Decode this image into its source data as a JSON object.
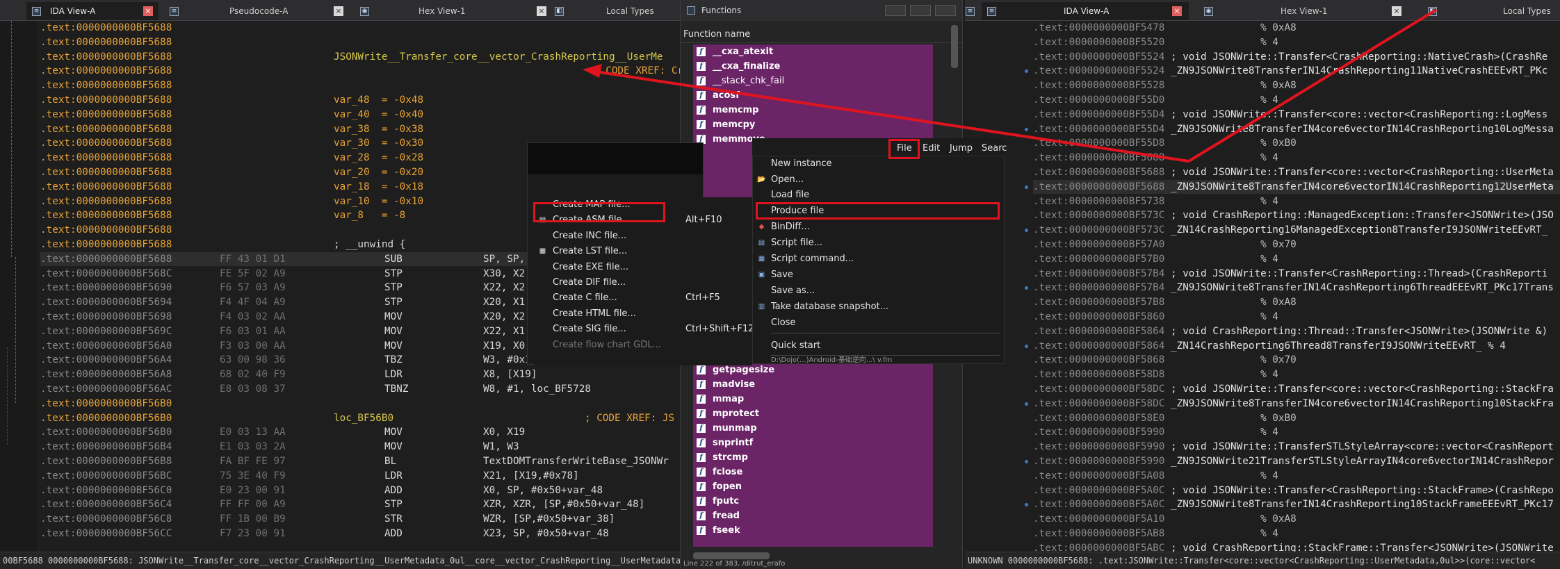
{
  "left": {
    "tabs": [
      {
        "label": "IDA View-A",
        "icon": "ida-view-icon",
        "active": true
      },
      {
        "label": "Pseudocode-A",
        "icon": "pseudocode-icon"
      },
      {
        "label": "Hex View-1",
        "icon": "hex-view-icon"
      },
      {
        "label": "Local Types",
        "icon": "local-types-icon"
      }
    ],
    "lines": [
      {
        "addr": ".text:0000000000BF5688",
        "hex": "",
        "a": "",
        "b": "",
        "c": ""
      },
      {
        "addr": ".text:0000000000BF5688",
        "hex": "",
        "a": "",
        "b": "",
        "c": ""
      },
      {
        "addr": ".text:0000000000BF5688",
        "hex": "",
        "a": "JSONWrite__Transfer_core__vector_CrashReporting__UserMe",
        "b": "",
        "c": ""
      },
      {
        "addr": ".text:0000000000BF5688",
        "hex": "",
        "a": "",
        "b": "",
        "c": "; CODE XREF: Cr"
      },
      {
        "addr": ".text:0000000000BF5688",
        "hex": "",
        "a": "",
        "b": "",
        "c": ""
      },
      {
        "addr": ".text:0000000000BF5688",
        "hex": "",
        "a": "var_48  = -0x48",
        "b": "",
        "c": ""
      },
      {
        "addr": ".text:0000000000BF5688",
        "hex": "",
        "a": "var_40  = -0x40",
        "b": "",
        "c": ""
      },
      {
        "addr": ".text:0000000000BF5688",
        "hex": "",
        "a": "var_38  = -0x38",
        "b": "",
        "c": ""
      },
      {
        "addr": ".text:0000000000BF5688",
        "hex": "",
        "a": "var_30  = -0x30",
        "b": "",
        "c": ""
      },
      {
        "addr": ".text:0000000000BF5688",
        "hex": "",
        "a": "var_28  = -0x28",
        "b": "",
        "c": ""
      },
      {
        "addr": ".text:0000000000BF5688",
        "hex": "",
        "a": "var_20  = -0x20",
        "b": "",
        "c": ""
      },
      {
        "addr": ".text:0000000000BF5688",
        "hex": "",
        "a": "var_18  = -0x18",
        "b": "",
        "c": ""
      },
      {
        "addr": ".text:0000000000BF5688",
        "hex": "",
        "a": "var_10  = -0x10",
        "b": "",
        "c": ""
      },
      {
        "addr": ".text:0000000000BF5688",
        "hex": "",
        "a": "var_8   = -8",
        "b": "",
        "c": ""
      },
      {
        "addr": ".text:0000000000BF5688",
        "hex": "",
        "a": "",
        "b": "",
        "c": ""
      },
      {
        "addr": ".text:0000000000BF5688",
        "hex": "",
        "a": "; __unwind {",
        "b": "",
        "c": ""
      },
      {
        "addr": ".text:0000000000BF5688",
        "hex": "FF 43 01 D1",
        "a": "SUB",
        "b": "SP, SP,",
        "c": ""
      },
      {
        "addr": ".text:0000000000BF568C",
        "hex": "FE 5F 02 A9",
        "a": "STP",
        "b": "X30, X2",
        "c": ""
      },
      {
        "addr": ".text:0000000000BF5690",
        "hex": "F6 57 03 A9",
        "a": "STP",
        "b": "X22, X2",
        "c": ""
      },
      {
        "addr": ".text:0000000000BF5694",
        "hex": "F4 4F 04 A9",
        "a": "STP",
        "b": "X20, X1",
        "c": ""
      },
      {
        "addr": ".text:0000000000BF5698",
        "hex": "F4 03 02 AA",
        "a": "MOV",
        "b": "X20, X2",
        "c": ""
      },
      {
        "addr": ".text:0000000000BF569C",
        "hex": "F6 03 01 AA",
        "a": "MOV",
        "b": "X22, X1",
        "c": ""
      },
      {
        "addr": ".text:0000000000BF56A0",
        "hex": "F3 03 00 AA",
        "a": "MOV",
        "b": "X19, X0",
        "c": ""
      },
      {
        "addr": ".text:0000000000BF56A4",
        "hex": "63 00 98 36",
        "a": "TBZ",
        "b": "W3, #0x13, loc_BF56B0",
        "c": ""
      },
      {
        "addr": ".text:0000000000BF56A8",
        "hex": "68 02 40 F9",
        "a": "LDR",
        "b": "X8, [X19]",
        "c": ""
      },
      {
        "addr": ".text:0000000000BF56AC",
        "hex": "E8 03 08 37",
        "a": "TBNZ",
        "b": "W8, #1, loc_BF5728",
        "c": ""
      },
      {
        "addr": ".text:0000000000BF56B0",
        "hex": "",
        "a": "",
        "b": "",
        "c": ""
      },
      {
        "addr": ".text:0000000000BF56B0",
        "hex": "",
        "a": "loc_BF56B0",
        "b": "",
        "c": "; CODE XREF: JS"
      },
      {
        "addr": ".text:0000000000BF56B0",
        "hex": "E0 03 13 AA",
        "a": "MOV",
        "b": "X0, X19",
        "c": ""
      },
      {
        "addr": ".text:0000000000BF56B4",
        "hex": "E1 03 03 2A",
        "a": "MOV",
        "b": "W1, W3",
        "c": ""
      },
      {
        "addr": ".text:0000000000BF56B8",
        "hex": "FA BF FE 97",
        "a": "BL",
        "b": "TextDOMTransferWriteBase_JSONWr",
        "c": ""
      },
      {
        "addr": ".text:0000000000BF56BC",
        "hex": "75 3E 40 F9",
        "a": "LDR",
        "b": "X21, [X19,#0x78]",
        "c": ""
      },
      {
        "addr": ".text:0000000000BF56C0",
        "hex": "E0 23 00 91",
        "a": "ADD",
        "b": "X0, SP, #0x50+var_48",
        "c": ""
      },
      {
        "addr": ".text:0000000000BF56C4",
        "hex": "FF FF 00 A9",
        "a": "STP",
        "b": "XZR, XZR, [SP,#0x50+var_48]",
        "c": ""
      },
      {
        "addr": ".text:0000000000BF56C8",
        "hex": "FF 1B 00 B9",
        "a": "STR",
        "b": "WZR, [SP,#0x50+var_38]",
        "c": ""
      },
      {
        "addr": ".text:0000000000BF56CC",
        "hex": "F7 23 00 91",
        "a": "ADD",
        "b": "X23, SP, #0x50+var_48",
        "c": ""
      }
    ],
    "status": "00BF5688 0000000000BF5688: JSONWrite__Transfer_core__vector_CrashReporting__UserMetadata_0ul__core__vector_CrashReporting__UserMetadata"
  },
  "functions": {
    "title": "Functions",
    "header": "Function name",
    "top_items": [
      "__cxa_atexit",
      "__cxa_finalize",
      "__stack_chk_fail",
      "acosf",
      "memcmp",
      "memcpy",
      "memmove"
    ],
    "bottom_items": [
      "getpagesize",
      "madvise",
      "mmap",
      "mprotect",
      "munmap",
      "snprintf",
      "strcmp",
      "fclose",
      "fopen",
      "fputc",
      "fread",
      "fseek"
    ],
    "footer": "Line 222 of 383, /ditrut_erafo"
  },
  "menubar": {
    "items": [
      "File",
      "Edit",
      "Jump",
      "Searc"
    ]
  },
  "file_menu": {
    "items": [
      {
        "label": "New instance",
        "icon": "",
        "interactable": true
      },
      {
        "label": "Open...",
        "icon": "folder-open-icon",
        "interactable": true
      },
      {
        "label": "Load file",
        "icon": "",
        "interactable": true
      },
      {
        "label": "Produce file",
        "icon": "",
        "interactable": true
      },
      {
        "label": "BinDiff...",
        "icon": "bindiff-icon",
        "interactable": true
      },
      {
        "label": "Script file...",
        "icon": "script-file-icon",
        "interactable": true
      },
      {
        "label": "Script command...",
        "icon": "script-command-icon",
        "interactable": true
      },
      {
        "label": "Save",
        "icon": "save-icon",
        "interactable": true
      },
      {
        "label": "Save as...",
        "icon": "",
        "interactable": true
      },
      {
        "label": "Take database snapshot...",
        "icon": "snapshot-icon",
        "interactable": true
      },
      {
        "label": "Close",
        "icon": "",
        "interactable": true
      },
      {
        "label": "Quick start",
        "icon": "",
        "interactable": true
      }
    ],
    "recent": "D:\\Dojo(...)Android-基础逆向...\\ v.fm"
  },
  "produce_submenu": {
    "items": [
      {
        "label": "Create MAP file...",
        "shortcut": ""
      },
      {
        "label": "Create ASM file...",
        "shortcut": "Alt+F10"
      },
      {
        "label": "Create INC file...",
        "shortcut": ""
      },
      {
        "label": "Create LST file...",
        "shortcut": ""
      },
      {
        "label": "Create EXE file...",
        "shortcut": ""
      },
      {
        "label": "Create DIF file...",
        "shortcut": ""
      },
      {
        "label": "Create C file...",
        "shortcut": "Ctrl+F5"
      },
      {
        "label": "Create HTML file...",
        "shortcut": ""
      },
      {
        "label": "Create SIG file...",
        "shortcut": "Ctrl+Shift+F12"
      },
      {
        "label": "Create flow chart GDL...",
        "shortcut": "",
        "disabled": true
      }
    ]
  },
  "right": {
    "tabs": [
      {
        "label": "IDA View-A",
        "icon": "ida-view-icon",
        "active": true
      },
      {
        "label": "Hex View-1",
        "icon": "hex-view-icon"
      },
      {
        "label": "Local Types",
        "icon": "local-types-icon"
      }
    ],
    "lines": [
      {
        "addr": ".text:0000000000BF5478",
        "body": "                % 0xA8",
        "kind": "pct"
      },
      {
        "addr": ".text:0000000000BF5520",
        "body": "                % 4",
        "kind": "pct"
      },
      {
        "addr": ".text:0000000000BF5524",
        "body": " ; void JSONWrite::Transfer<CrashReporting::NativeCrash>(CrashRe",
        "kind": "decl"
      },
      {
        "addr": ".text:0000000000BF5524",
        "body": " _ZN9JSONWrite8TransferIN14CrashReporting11NativeCrashEEEvRT_PKc",
        "kind": "decl"
      },
      {
        "addr": ".text:0000000000BF5528",
        "body": "                % 0xA8",
        "kind": "pct"
      },
      {
        "addr": ".text:0000000000BF55D0",
        "body": "                % 4",
        "kind": "pct"
      },
      {
        "addr": ".text:0000000000BF55D4",
        "body": " ; void JSONWrite::Transfer<core::vector<CrashReporting::LogMess",
        "kind": "decl"
      },
      {
        "addr": ".text:0000000000BF55D4",
        "body": " _ZN9JSONWrite8TransferIN4core6vectorIN14CrashReporting10LogMessa",
        "kind": "decl"
      },
      {
        "addr": ".text:0000000000BF55D8",
        "body": "                % 0xB0",
        "kind": "pct"
      },
      {
        "addr": ".text:0000000000BF5688",
        "body": "                % 4",
        "kind": "pct"
      },
      {
        "addr": ".text:0000000000BF5688",
        "body": " ; void JSONWrite::Transfer<core::vector<CrashReporting::UserMeta",
        "kind": "decl"
      },
      {
        "addr": ".text:0000000000BF5688",
        "body": " _ZN9JSONWrite8TransferIN4core6vectorIN14CrashReporting12UserMeta",
        "kind": "decl"
      },
      {
        "addr": ".text:0000000000BF5738",
        "body": "                % 4",
        "kind": "pct"
      },
      {
        "addr": ".text:0000000000BF573C",
        "body": " ; void CrashReporting::ManagedException::Transfer<JSONWrite>(JSO",
        "kind": "decl"
      },
      {
        "addr": ".text:0000000000BF573C",
        "body": " _ZN14CrashReporting16ManagedException8TransferI9JSONWriteEEvRT_",
        "kind": "decl"
      },
      {
        "addr": ".text:0000000000BF57A0",
        "body": "                % 0x70",
        "kind": "pct"
      },
      {
        "addr": ".text:0000000000BF57B0",
        "body": "                % 4",
        "kind": "pct"
      },
      {
        "addr": ".text:0000000000BF57B4",
        "body": " ; void JSONWrite::Transfer<CrashReporting::Thread>(CrashReporti",
        "kind": "decl"
      },
      {
        "addr": ".text:0000000000BF57B4",
        "body": " _ZN9JSONWrite8TransferIN14CrashReporting6ThreadEEEvRT_PKc17Trans",
        "kind": "decl"
      },
      {
        "addr": ".text:0000000000BF57B8",
        "body": "                % 0xA8",
        "kind": "pct"
      },
      {
        "addr": ".text:0000000000BF5860",
        "body": "                % 4",
        "kind": "pct"
      },
      {
        "addr": ".text:0000000000BF5864",
        "body": " ; void CrashReporting::Thread::Transfer<JSONWrite>(JSONWrite &)",
        "kind": "decl"
      },
      {
        "addr": ".text:0000000000BF5864",
        "body": " _ZN14CrashReporting6Thread8TransferI9JSONWriteEEvRT_ % 4",
        "kind": "decl"
      },
      {
        "addr": ".text:0000000000BF5868",
        "body": "                % 0x70",
        "kind": "pct"
      },
      {
        "addr": ".text:0000000000BF58D8",
        "body": "                % 4",
        "kind": "pct"
      },
      {
        "addr": ".text:0000000000BF58DC",
        "body": " ; void JSONWrite::Transfer<core::vector<CrashReporting::StackFra",
        "kind": "decl"
      },
      {
        "addr": ".text:0000000000BF58DC",
        "body": " _ZN9JSONWrite8TransferIN4core6vectorIN14CrashReporting10StackFra",
        "kind": "decl"
      },
      {
        "addr": ".text:0000000000BF58E0",
        "body": "                % 0xB0",
        "kind": "pct"
      },
      {
        "addr": ".text:0000000000BF5990",
        "body": "                % 4",
        "kind": "pct"
      },
      {
        "addr": ".text:0000000000BF5990",
        "body": " ; void JSONWrite::TransferSTLStyleArray<core::vector<CrashReport",
        "kind": "decl"
      },
      {
        "addr": ".text:0000000000BF5990",
        "body": " _ZN9JSONWrite21TransferSTLStyleArrayIN4core6vectorIN14CrashRepor",
        "kind": "decl"
      },
      {
        "addr": ".text:0000000000BF5A08",
        "body": "                % 4",
        "kind": "pct"
      },
      {
        "addr": ".text:0000000000BF5A0C",
        "body": " ; void JSONWrite::Transfer<CrashReporting::StackFrame>(CrashRepo",
        "kind": "decl"
      },
      {
        "addr": ".text:0000000000BF5A0C",
        "body": " _ZN9JSONWrite8TransferIN14CrashReporting10StackFrameEEEvRT_PKc17",
        "kind": "decl"
      },
      {
        "addr": ".text:0000000000BF5A10",
        "body": "                % 0xA8",
        "kind": "pct"
      },
      {
        "addr": ".text:0000000000BF5AB8",
        "body": "                % 4",
        "kind": "pct"
      },
      {
        "addr": ".text:0000000000BF5ABC",
        "body": " ; void CrashReporting::StackFrame::Transfer<JSONWrite>(JSONWrite",
        "kind": "decl"
      },
      {
        "addr": ".text:0000000000BF5ABC",
        "body": " _ZN14CrashReporting10StackFrame8TransferI9JSONWriteEEvRT_ % 4",
        "kind": "decl"
      }
    ],
    "status": "UNKNOWN 0000000000BF5688: .text:JSONWrite::Transfer<core::vector<CrashReporting::UserMetadata,0ul>>(core::vector<"
  },
  "colors": {
    "highlight": "#e0141e",
    "function_list_bg": "#6b2567",
    "address": "#e8a336"
  }
}
